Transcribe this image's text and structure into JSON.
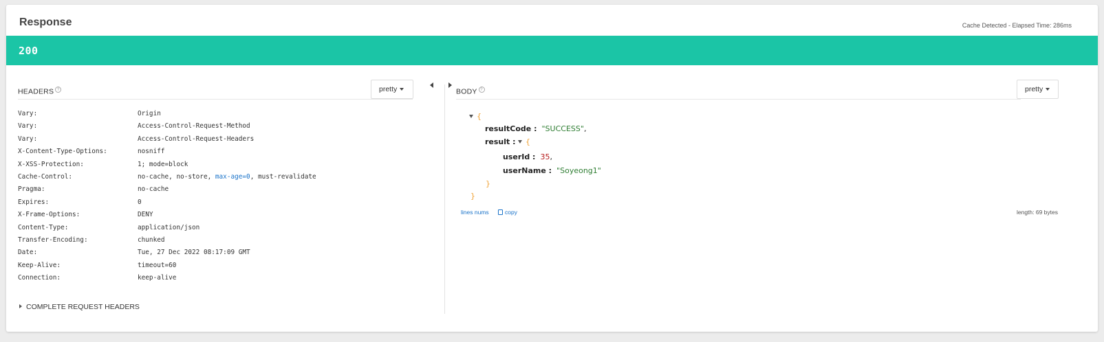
{
  "response": {
    "title": "Response",
    "cache_info": "Cache Detected - Elapsed Time: 286ms",
    "status_code": "200",
    "status_color": "#1bc5a6"
  },
  "headers_pane": {
    "title": "HEADERS",
    "help_icon": "?",
    "format_label": "pretty",
    "rows": [
      {
        "key": "Vary:",
        "value": "Origin"
      },
      {
        "key": "Vary:",
        "value": "Access-Control-Request-Method"
      },
      {
        "key": "Vary:",
        "value": "Access-Control-Request-Headers"
      },
      {
        "key": "X-Content-Type-Options:",
        "value": "nosniff"
      },
      {
        "key": "X-XSS-Protection:",
        "value": "1; mode=block"
      },
      {
        "key": "Cache-Control:",
        "value_parts": [
          "no-cache, no-store, ",
          "max-age=0",
          ", must-revalidate"
        ]
      },
      {
        "key": "Pragma:",
        "value": "no-cache"
      },
      {
        "key": "Expires:",
        "value": "0"
      },
      {
        "key": "X-Frame-Options:",
        "value": "DENY"
      },
      {
        "key": "Content-Type:",
        "value": "application/json"
      },
      {
        "key": "Transfer-Encoding:",
        "value": "chunked"
      },
      {
        "key": "Date:",
        "value": "Tue, 27 Dec 2022 08:17:09 GMT"
      },
      {
        "key": "Keep-Alive:",
        "value": "timeout=60"
      },
      {
        "key": "Connection:",
        "value": "keep-alive"
      }
    ],
    "complete_request_headers": "COMPLETE REQUEST HEADERS"
  },
  "body_pane": {
    "title": "BODY",
    "help_icon": "?",
    "format_label": "pretty",
    "json": {
      "open_brace": "{",
      "close_brace": "}",
      "resultCode_key": "resultCode :",
      "resultCode_value": "\"SUCCESS\"",
      "result_key": "result :",
      "userId_key": "userId :",
      "userId_value": "35",
      "userName_key": "userName :",
      "userName_value": "\"Soyeong1\""
    },
    "lines_nums_label": "lines nums",
    "copy_label": "copy",
    "length_label": "length: 69 bytes"
  }
}
